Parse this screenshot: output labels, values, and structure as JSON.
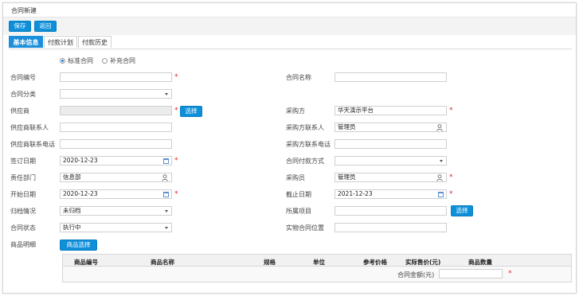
{
  "window": {
    "title": "合同新建"
  },
  "toolbar": {
    "save_label": "保存",
    "back_label": "返回"
  },
  "tabs": [
    {
      "label": "基本信息",
      "active": true
    },
    {
      "label": "付款计划",
      "active": false
    },
    {
      "label": "付款历史",
      "active": false
    }
  ],
  "contract_type": {
    "option1": "标准合同",
    "option2": "补充合同",
    "selected": "标准合同"
  },
  "form": {
    "contract_no": {
      "label": "合同编号",
      "value": ""
    },
    "contract_name": {
      "label": "合同名称",
      "value": ""
    },
    "contract_category": {
      "label": "合同分类",
      "value": ""
    },
    "supplier": {
      "label": "供应商",
      "value": "",
      "select_label": "选择"
    },
    "purchaser": {
      "label": "采购方",
      "value": "华天演示平台"
    },
    "supplier_contact": {
      "label": "供应商联系人",
      "value": ""
    },
    "purchaser_contact": {
      "label": "采购方联系人",
      "value": "管理员"
    },
    "supplier_phone": {
      "label": "供应商联系电话",
      "value": ""
    },
    "purchaser_phone": {
      "label": "采购方联系电话",
      "value": ""
    },
    "sign_date": {
      "label": "签订日期",
      "value": "2020-12-23"
    },
    "payment_method": {
      "label": "合同付款方式",
      "value": ""
    },
    "department": {
      "label": "责任部门",
      "value": "信息部"
    },
    "buyer": {
      "label": "采购员",
      "value": "管理员"
    },
    "start_date": {
      "label": "开始日期",
      "value": "2020-12-23"
    },
    "end_date": {
      "label": "截止日期",
      "value": "2021-12-23"
    },
    "archive_status": {
      "label": "归档情况",
      "value": "未归档"
    },
    "project": {
      "label": "所属项目",
      "value": "",
      "select_label": "选择"
    },
    "contract_status": {
      "label": "合同状态",
      "value": "执行中"
    },
    "physical_location": {
      "label": "实物合同位置",
      "value": ""
    },
    "goods_detail": {
      "label": "商品明细",
      "select_label": "商品选择"
    }
  },
  "goods_table": {
    "columns": [
      "商品编号",
      "商品名称",
      "规格",
      "单位",
      "参考价格",
      "实际售价(元)",
      "商品数量"
    ],
    "amount_label": "合同金额(元)",
    "amount_value": ""
  },
  "colors": {
    "accent": "#0e8fd9",
    "required": "#e0242f"
  }
}
